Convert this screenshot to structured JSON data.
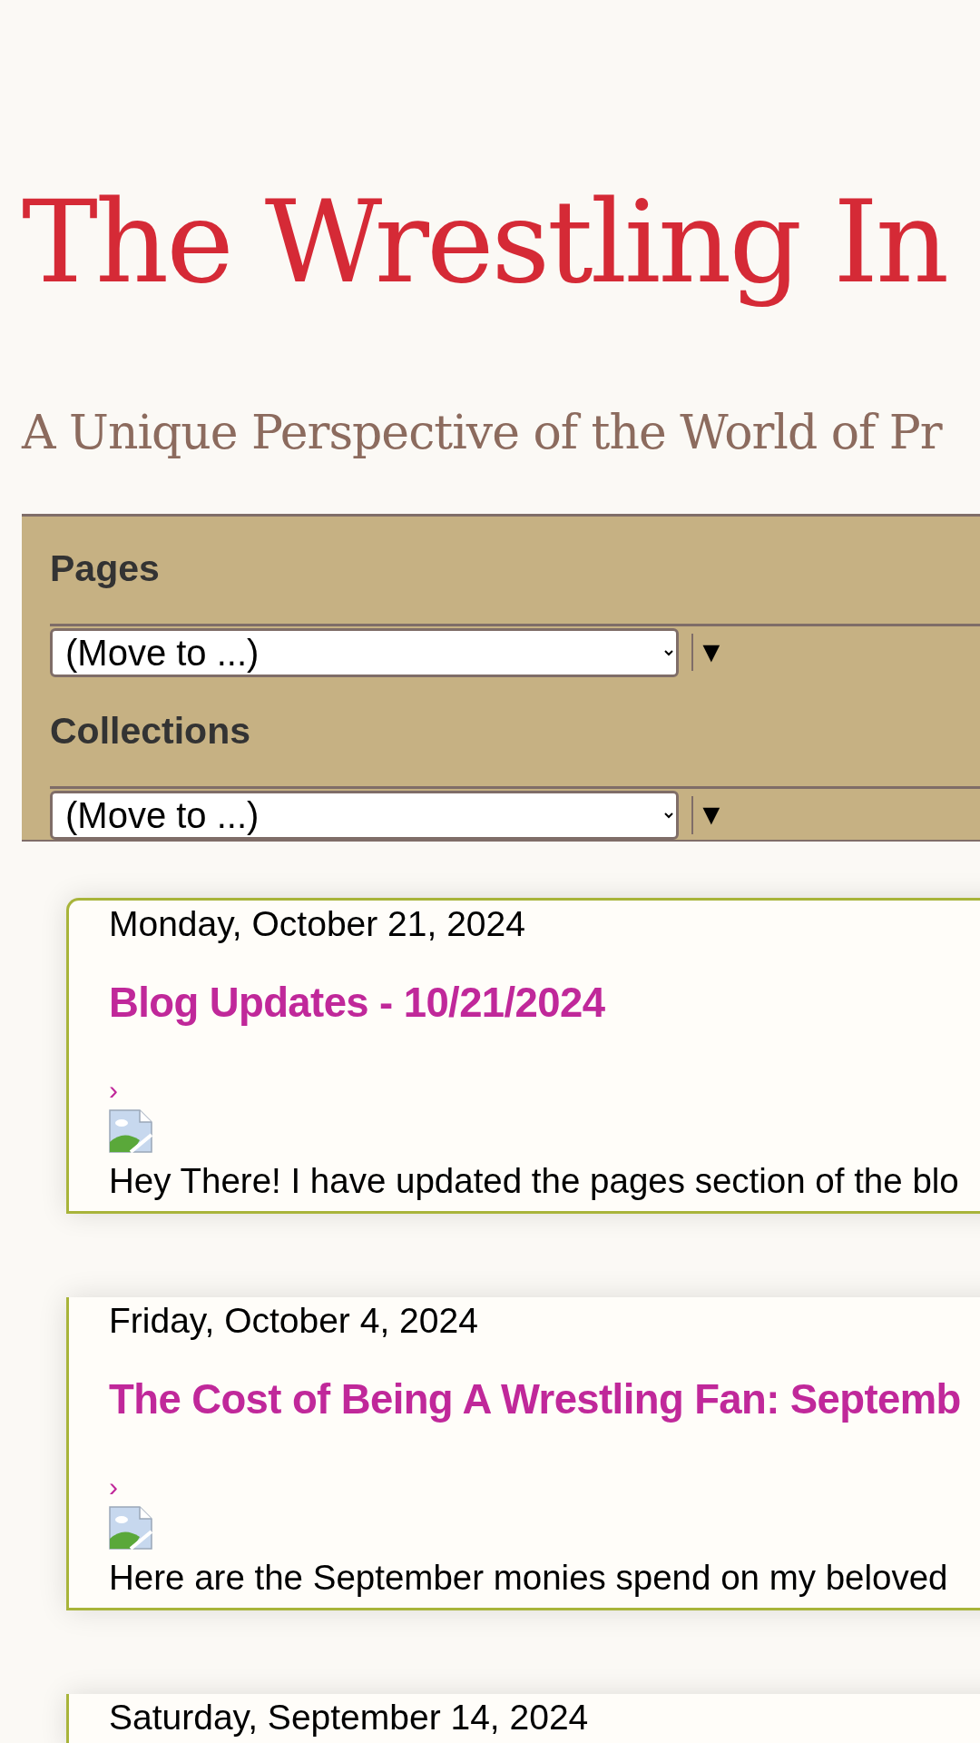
{
  "blog": {
    "title": "The Wrestling In",
    "subtitle": "A Unique Perspective of the World of Pr"
  },
  "nav": [
    {
      "heading": "Pages",
      "select": "(Move to ...)",
      "toggle": "▼"
    },
    {
      "heading": "Collections",
      "select": "(Move to ...)",
      "toggle": "▼"
    }
  ],
  "posts": [
    {
      "date": "Monday, October 21, 2024",
      "title": "Blog Updates - 10/21/2024",
      "more": "›",
      "body": "Hey There! I have updated the pages section of the blo"
    },
    {
      "date": "Friday, October 4, 2024",
      "title": "The Cost of Being A Wrestling Fan: Septemb",
      "more": "›",
      "body": "Here are the September monies spend on my beloved"
    },
    {
      "date": "Saturday, September 14, 2024"
    }
  ]
}
